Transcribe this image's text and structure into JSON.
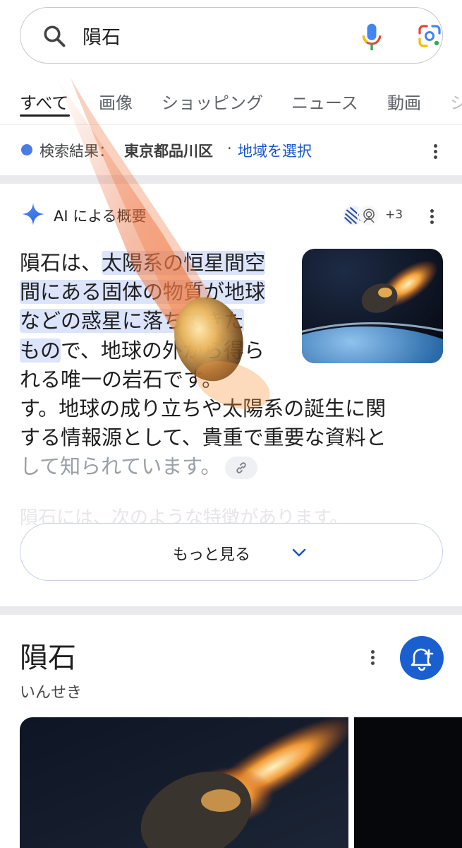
{
  "search": {
    "query": "隕石"
  },
  "tabs": [
    {
      "label": "すべて",
      "active": true
    },
    {
      "label": "画像"
    },
    {
      "label": "ショッピング"
    },
    {
      "label": "ニュース"
    },
    {
      "label": "動画"
    },
    {
      "label": "シ"
    }
  ],
  "location": {
    "prefix": "検索結果：",
    "place": "東京都品川区",
    "separator": "·",
    "link": "地域を選択"
  },
  "ai_overview": {
    "title": "AI による概要",
    "source_count": "+3",
    "lines": [
      [
        "隕石は、",
        "太陽系の恒星間空"
      ],
      [
        "",
        "間にある固体の物質が地球"
      ],
      [
        "",
        "などの惑星に落ちてきた"
      ],
      [
        "もの",
        "で、地球の外から得ら"
      ],
      [
        "れる唯一の岩石です。",
        ""
      ],
      [
        "す。地球の成り立ちや太陽系の誕生に関",
        ""
      ],
      [
        "する情報源として、貴重で重要な資料と",
        ""
      ],
      [
        "して知られています。",
        ""
      ]
    ],
    "faded_next": "隕石には、次のような特徴があります。",
    "more_label": "もっと見る"
  },
  "knowledge_panel": {
    "title": "隕石",
    "reading": "いんせき"
  },
  "colors": {
    "accent": "#1a55c9",
    "highlight": "#dbe4fb",
    "bell_bg": "#1a5fd0",
    "band": "#e9e9ee"
  }
}
